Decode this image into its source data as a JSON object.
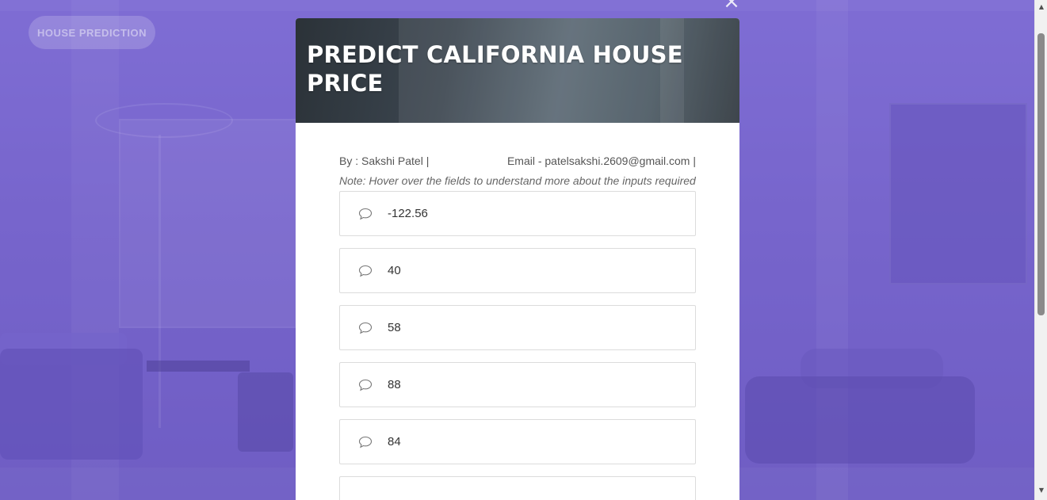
{
  "nav": {
    "brand_label": "HOUSE PREDICTION"
  },
  "modal": {
    "close_icon": "×",
    "title": "PREDICT CALIFORNIA HOUSE PRICE",
    "byline_author": "By : Sakshi Patel |",
    "byline_email": "Email - patelsakshi.2609@gmail.com |",
    "note": "Note: Hover over the fields to understand more about the inputs required",
    "fields": [
      {
        "value": "-122.56",
        "icon": "comment-icon"
      },
      {
        "value": "40",
        "icon": "comment-icon"
      },
      {
        "value": "58",
        "icon": "comment-icon"
      },
      {
        "value": "88",
        "icon": "comment-icon"
      },
      {
        "value": "84",
        "icon": "comment-icon"
      }
    ]
  },
  "colors": {
    "overlay": "#7a68c9",
    "header_dark": "#2b3238",
    "field_border": "#dcdcdc"
  }
}
